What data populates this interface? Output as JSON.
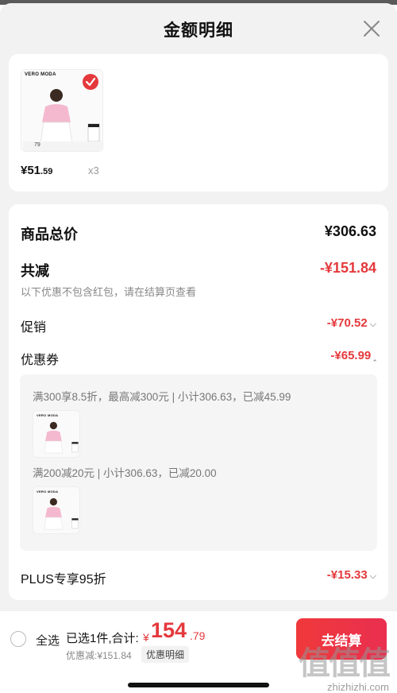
{
  "header": {
    "title": "金额明细"
  },
  "product": {
    "brand": "VERO MODA",
    "price_int": "¥51",
    "price_dec": ".59",
    "quantity": "x3",
    "tag_price": "79"
  },
  "summary": {
    "total_label": "商品总价",
    "total_value": "¥306.63",
    "reduce_label": "共减",
    "reduce_value": "-¥151.84",
    "note": "以下优惠不包含红包，请在结算页查看",
    "promo_label": "促销",
    "promo_value": "-¥70.52",
    "coupon_label": "优惠券",
    "coupon_value": "-¥65.99",
    "coupon_lines": [
      "满300享8.5折，最高减300元 | 小计306.63，已减45.99",
      "满200减20元 | 小计306.63，已减20.00"
    ],
    "plus_label": "PLUS专享95折",
    "plus_value": "-¥15.33"
  },
  "bottom": {
    "select_all": "全选",
    "selected_text": "已选1件,合计:",
    "total_yen": "¥",
    "total_int": "154",
    "total_dec": ".79",
    "discount_note": "优惠减:¥151.84",
    "detail_tag": "优惠明细",
    "checkout": "去结算"
  },
  "watermark": {
    "logo": "值值值",
    "url": "zhizhizhi.com"
  },
  "colors": {
    "accent": "#e4393c",
    "background": "#f2f2f2"
  },
  "icons": [
    "close-icon",
    "check-icon",
    "chevron-down-icon",
    "chevron-up-icon",
    "radio-icon"
  ]
}
